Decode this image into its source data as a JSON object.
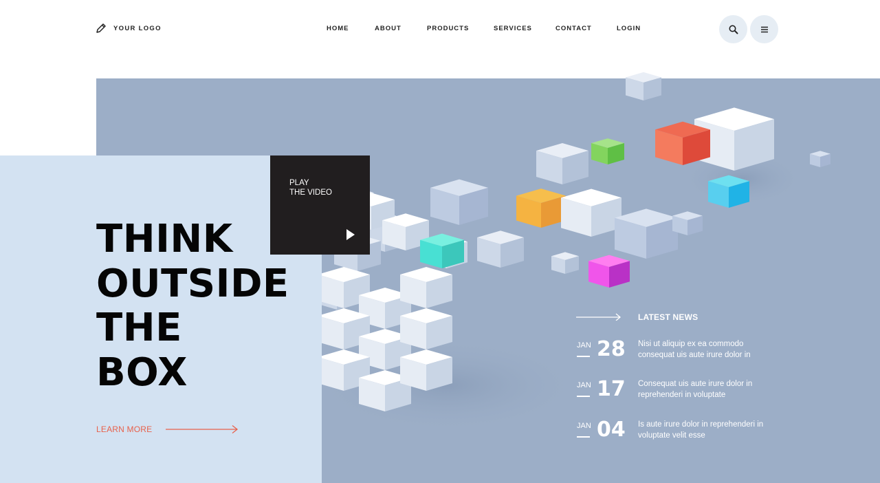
{
  "header": {
    "logo_text": "YOUR LOGO",
    "logo_icon": "pencil-icon",
    "nav": [
      "HOME",
      "ABOUT",
      "PRODUCTS",
      "SERVICES",
      "CONTACT",
      "LOGIN"
    ],
    "search_icon": "search-icon",
    "menu_icon": "hamburger-menu-icon"
  },
  "hero": {
    "headline": [
      "THINK",
      "OUTSIDE",
      "THE",
      "BOX"
    ],
    "learn_more": "LEARN MORE",
    "video_label_line1": "PLAY",
    "video_label_line2": "THE VIDEO",
    "play_icon": "play-icon"
  },
  "news": {
    "title": "LATEST NEWS",
    "items": [
      {
        "month": "JAN",
        "day": "28",
        "text": "Nisi ut aliquip ex ea commodo consequat uis aute irure dolor in"
      },
      {
        "month": "JAN",
        "day": "17",
        "text": "Consequat uis aute irure dolor in reprehenderi in voluptate"
      },
      {
        "month": "JAN",
        "day": "04",
        "text": "Is aute irure dolor in reprehenderi in voluptate velit esse"
      }
    ]
  },
  "colors": {
    "hero_background": "#9caec7",
    "left_panel": "#d3e2f2",
    "video_box": "#211e1f",
    "accent": "#e8614b",
    "button_bg": "#e6edf4"
  }
}
